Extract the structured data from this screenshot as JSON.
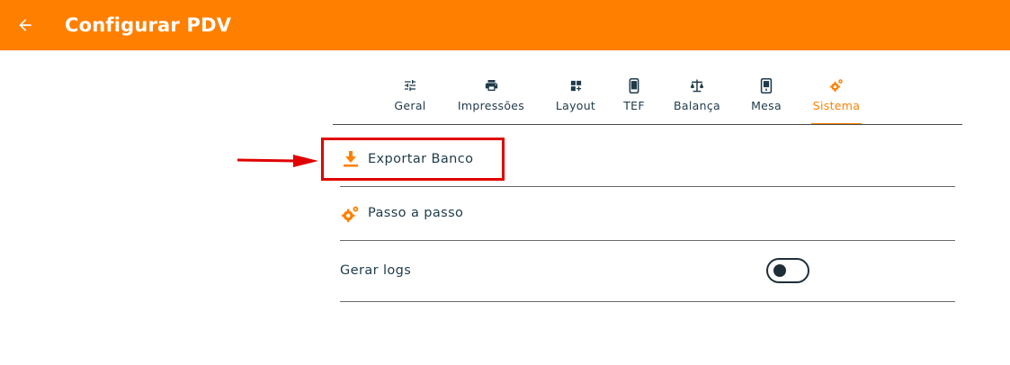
{
  "appbar": {
    "title": "Configurar PDV",
    "back_icon": "arrow-left-icon",
    "color": "#ff8000"
  },
  "tabs": [
    {
      "label": "Geral",
      "icon": "sliders-icon",
      "active": false
    },
    {
      "label": "Impressões",
      "icon": "printer-icon",
      "active": false
    },
    {
      "label": "Layout",
      "icon": "layout-grid-icon",
      "active": false
    },
    {
      "label": "TEF",
      "icon": "phone-icon",
      "active": false
    },
    {
      "label": "Balança",
      "icon": "scale-icon",
      "active": false
    },
    {
      "label": "Mesa",
      "icon": "tablet-icon",
      "active": false
    },
    {
      "label": "Sistema",
      "icon": "gears-icon",
      "active": true
    }
  ],
  "settings": {
    "export": {
      "label": "Exportar Banco",
      "icon": "download-icon"
    },
    "steps": {
      "label": "Passo a passo",
      "icon": "gears-icon"
    },
    "logs": {
      "label": "Gerar logs",
      "toggle_on": false
    }
  },
  "annotation": {
    "color": "#e00000"
  }
}
